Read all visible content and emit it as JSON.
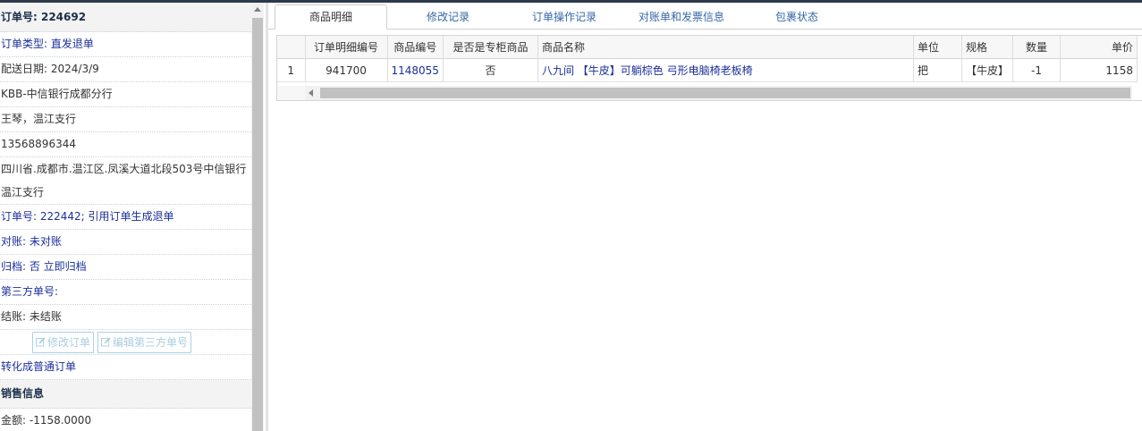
{
  "left": {
    "order_title": "订单号: 224692",
    "order_type": "订单类型: 直发退单",
    "delivery_date": "配送日期: 2024/3/9",
    "customer": "KBB-中信银行成都分行",
    "contact": "王琴，温江支行",
    "phone": "13568896344",
    "address": "四川省.成都市.温江区.凤溪大道北段503号中信银行温江支行",
    "ref_order": "订单号: 222442; 引用订单生成退单",
    "reconcile": "对账: 未对账",
    "archive": "归档: 否 立即归档",
    "third_party": "第三方单号:",
    "settle": "结账: 未结账",
    "btn_modify": "修改订单",
    "btn_edit_third": "编辑第三方单号",
    "convert": "转化成普通订单",
    "sales_section": "销售信息",
    "amount": "金额: -1158.0000"
  },
  "tabs": [
    "商品明细",
    "修改记录",
    "订单操作记录",
    "对账单和发票信息",
    "包裹状态"
  ],
  "grid": {
    "columns": [
      "订单明细编号",
      "商品编号",
      "是否是专柜商品",
      "商品名称",
      "单位",
      "规格",
      "数量",
      "单价"
    ],
    "rows": [
      {
        "index": "1",
        "detail_id": "941700",
        "product_id": "1148055",
        "counter": "否",
        "name": "八九间 【牛皮】可躺棕色 弓形电脑椅老板椅",
        "unit": "把",
        "spec": "【牛皮】",
        "qty": "-1",
        "price": "1158"
      }
    ]
  },
  "icons": {
    "edit": "edit-icon",
    "scroll_up": "scroll-up-arrow-icon",
    "scroll_left": "scroll-left-arrow-icon"
  }
}
